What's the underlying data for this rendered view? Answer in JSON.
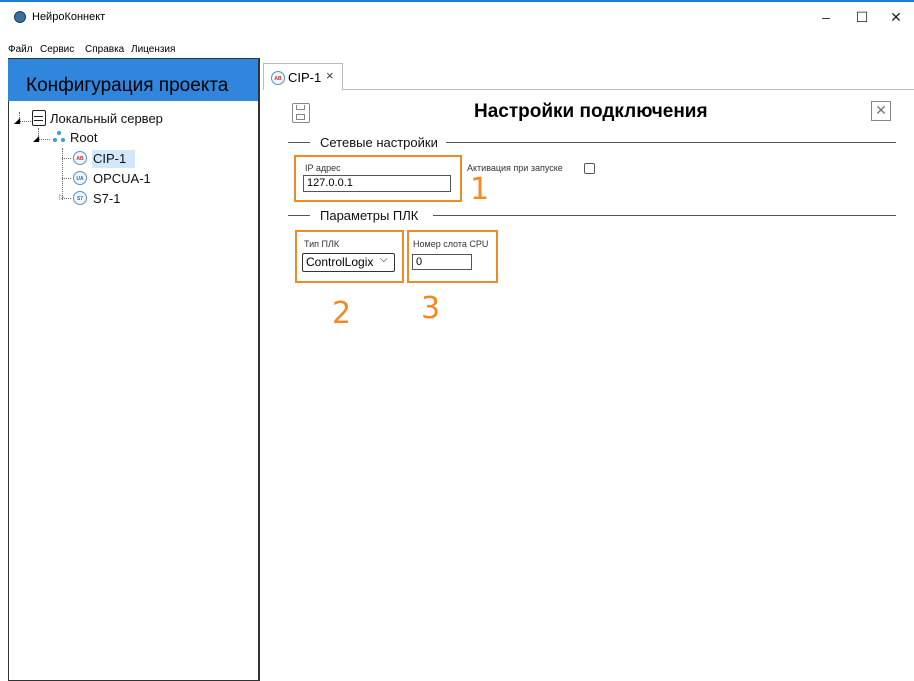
{
  "window": {
    "title": "НейроКоннект",
    "controls": {
      "minimize": "–",
      "maximize": "☐",
      "close": "✕"
    }
  },
  "menu": {
    "items": [
      {
        "label": "Файл"
      },
      {
        "label": "Сервис"
      },
      {
        "label": "Справка"
      },
      {
        "label": "Лицензия"
      }
    ]
  },
  "sidebar": {
    "header": "Конфигурация проекта",
    "tree": {
      "server": "Локальный сервер",
      "root": "Root",
      "items": [
        {
          "badge": "AB",
          "label": "CIP-1"
        },
        {
          "badge": "UA",
          "label": "OPCUA-1"
        },
        {
          "badge": "S7",
          "label": "S7-1"
        }
      ]
    }
  },
  "tab": {
    "badge": "AB",
    "label": "CIP-1",
    "close": "×"
  },
  "content": {
    "title": "Настройки подключения",
    "network": {
      "section_title": "Сетевые настройки",
      "ip_label": "IP адрес",
      "ip_value": "127.0.0.1",
      "activation_label": "Активация при запуске",
      "activation_checked": false
    },
    "plc": {
      "section_title": "Параметры ПЛК",
      "type_label": "Тип ПЛК",
      "type_value": "ControlLogix",
      "slot_label": "Номер слота CPU",
      "slot_value": "0"
    },
    "annotations": [
      "1",
      "2",
      "3"
    ],
    "annotation_color": "#f08a24"
  },
  "colors": {
    "accent": "#2f86dc",
    "window_border": "#1c7fd6",
    "selection": "#d2e8fa"
  }
}
